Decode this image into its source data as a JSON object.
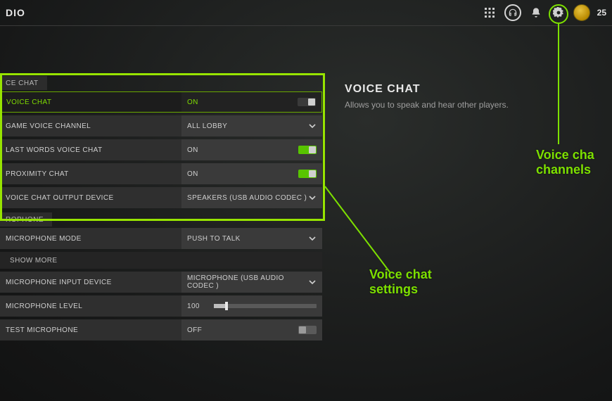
{
  "header": {
    "title_fragment": "DIO",
    "points": "25"
  },
  "info_panel": {
    "title": "VOICE CHAT",
    "desc": "Allows you to speak and hear other players."
  },
  "sections": {
    "voice_chat_header": "CE CHAT",
    "microphone_header": "ROPHONE"
  },
  "rows": {
    "voice_chat": {
      "label": "VOICE CHAT",
      "value": "ON",
      "toggle": "on",
      "selected": true
    },
    "game_channel": {
      "label": "GAME VOICE CHANNEL",
      "value": "ALL LOBBY"
    },
    "last_words": {
      "label": "LAST WORDS VOICE CHAT",
      "value": "ON",
      "toggle": "on"
    },
    "proximity": {
      "label": "PROXIMITY CHAT",
      "value": "ON",
      "toggle": "on"
    },
    "output_device": {
      "label": "VOICE CHAT OUTPUT DEVICE",
      "value": "SPEAKERS (USB AUDIO CODEC )"
    },
    "mic_mode": {
      "label": "MICROPHONE MODE",
      "value": "PUSH TO TALK"
    },
    "show_more": {
      "label": "SHOW MORE"
    },
    "mic_input": {
      "label": "MICROPHONE INPUT DEVICE",
      "value": "MICROPHONE (USB AUDIO CODEC )"
    },
    "mic_level": {
      "label": "MICROPHONE LEVEL",
      "value": "100",
      "percent": 12
    },
    "test_mic": {
      "label": "TEST MICROPHONE",
      "value": "OFF",
      "toggle": "off"
    }
  },
  "annotations": {
    "settings": "Voice chat\nsettings",
    "channels": "Voice cha\nchannels"
  },
  "icons": {
    "apps": "apps-grid-icon",
    "headset": "headset-icon",
    "bell": "bell-icon",
    "gear": "gear-icon",
    "avatar": "avatar-icon"
  },
  "colors": {
    "accent": "#7de000",
    "toggle_on": "#58c400"
  }
}
